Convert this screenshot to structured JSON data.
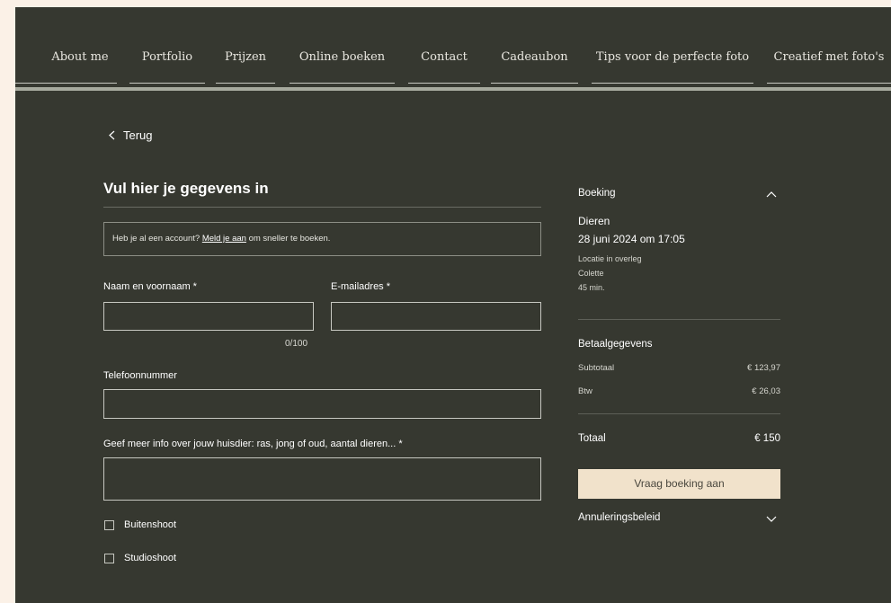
{
  "nav": {
    "items": [
      "About me",
      "Portfolio",
      "Prijzen",
      "Online boeken",
      "Contact",
      "Cadeaubon",
      "Tips voor de perfecte foto",
      "Creatief met foto's"
    ]
  },
  "back": {
    "label": "Terug"
  },
  "form": {
    "title": "Vul hier je gegevens in",
    "account_prefix": "Heb je al een account? ",
    "account_link": "Meld je aan",
    "account_suffix": " om sneller te boeken.",
    "name_label": "Naam en voornaam *",
    "email_label": "E-mailadres *",
    "name_value": "",
    "email_value": "",
    "name_counter": "0/100",
    "phone_label": "Telefoonnummer",
    "phone_value": "",
    "info_label": "Geef meer info over jouw huisdier: ras, jong of oud, aantal dieren... *",
    "info_value": "",
    "checkboxes": [
      {
        "label": "Buitenshoot",
        "checked": false
      },
      {
        "label": "Studioshoot",
        "checked": false
      }
    ]
  },
  "summary": {
    "header": "Boeking",
    "service": "Dieren",
    "datetime": "28 juni 2024 om 17:05",
    "location": "Locatie in overleg",
    "staff": "Colette",
    "duration": "45 min.",
    "payment_title": "Betaalgegevens",
    "subtotal_label": "Subtotaal",
    "subtotal_value": "€ 123,97",
    "tax_label": "Btw",
    "tax_value": "€ 26,03",
    "total_label": "Totaal",
    "total_value": "€ 150",
    "cta": "Vraag boeking aan",
    "cancel_policy": "Annuleringsbeleid"
  },
  "colors": {
    "page_bg": "#fbf1e7",
    "panel_bg": "#363830",
    "button_bg": "#f1e2cb",
    "button_text": "#4a473e"
  },
  "icons": {
    "back": "chevron-left-icon",
    "summary_toggle": "chevron-up-icon",
    "cancel_toggle": "chevron-down-icon"
  }
}
